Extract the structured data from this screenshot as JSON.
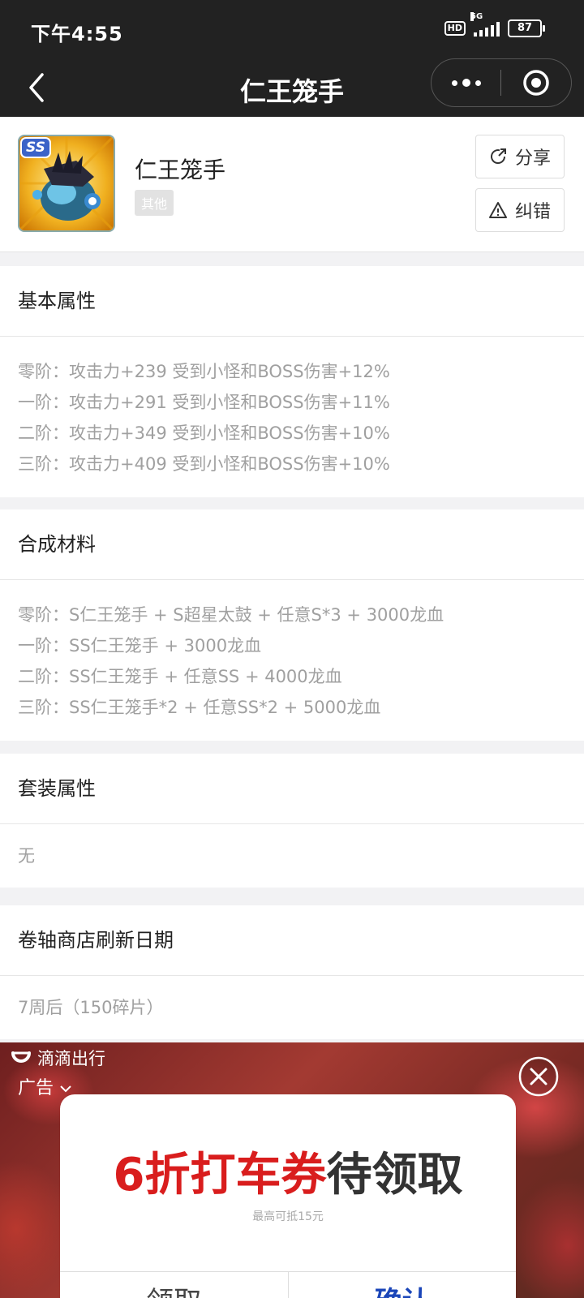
{
  "status_bar": {
    "time": "下午4:55",
    "network": "5G",
    "hd": "HD",
    "battery": "87"
  },
  "nav": {
    "title": "仁王笼手"
  },
  "item": {
    "name": "仁王笼手",
    "tag": "其他",
    "icon_badge": "SS",
    "share_label": "分享",
    "report_label": "纠错"
  },
  "sections": [
    {
      "title": "基本属性",
      "lines": [
        "零阶：攻击力+239 受到小怪和BOSS伤害+12%",
        "一阶：攻击力+291 受到小怪和BOSS伤害+11%",
        "二阶：攻击力+349 受到小怪和BOSS伤害+10%",
        "三阶：攻击力+409 受到小怪和BOSS伤害+10%"
      ]
    },
    {
      "title": "合成材料",
      "lines": [
        "零阶：S仁王笼手 + S超星太鼓 + 任意S*3 + 3000龙血",
        "一阶：SS仁王笼手 + 3000龙血",
        "二阶：SS仁王笼手 + 任意SS + 4000龙血",
        "三阶：SS仁王笼手*2 + 任意SS*2 + 5000龙血"
      ]
    },
    {
      "title": "套装属性",
      "lines": [
        "无"
      ]
    },
    {
      "title": "卷轴商店刷新日期",
      "lines": [
        "7周后（150碎片）"
      ]
    }
  ],
  "ad": {
    "brand": "滴滴出行",
    "label": "广告",
    "headline_red": "6折打车券",
    "headline_dark": "待领取",
    "subtext": "最高可抵15元",
    "button_left": "领取",
    "button_right": "确认"
  }
}
